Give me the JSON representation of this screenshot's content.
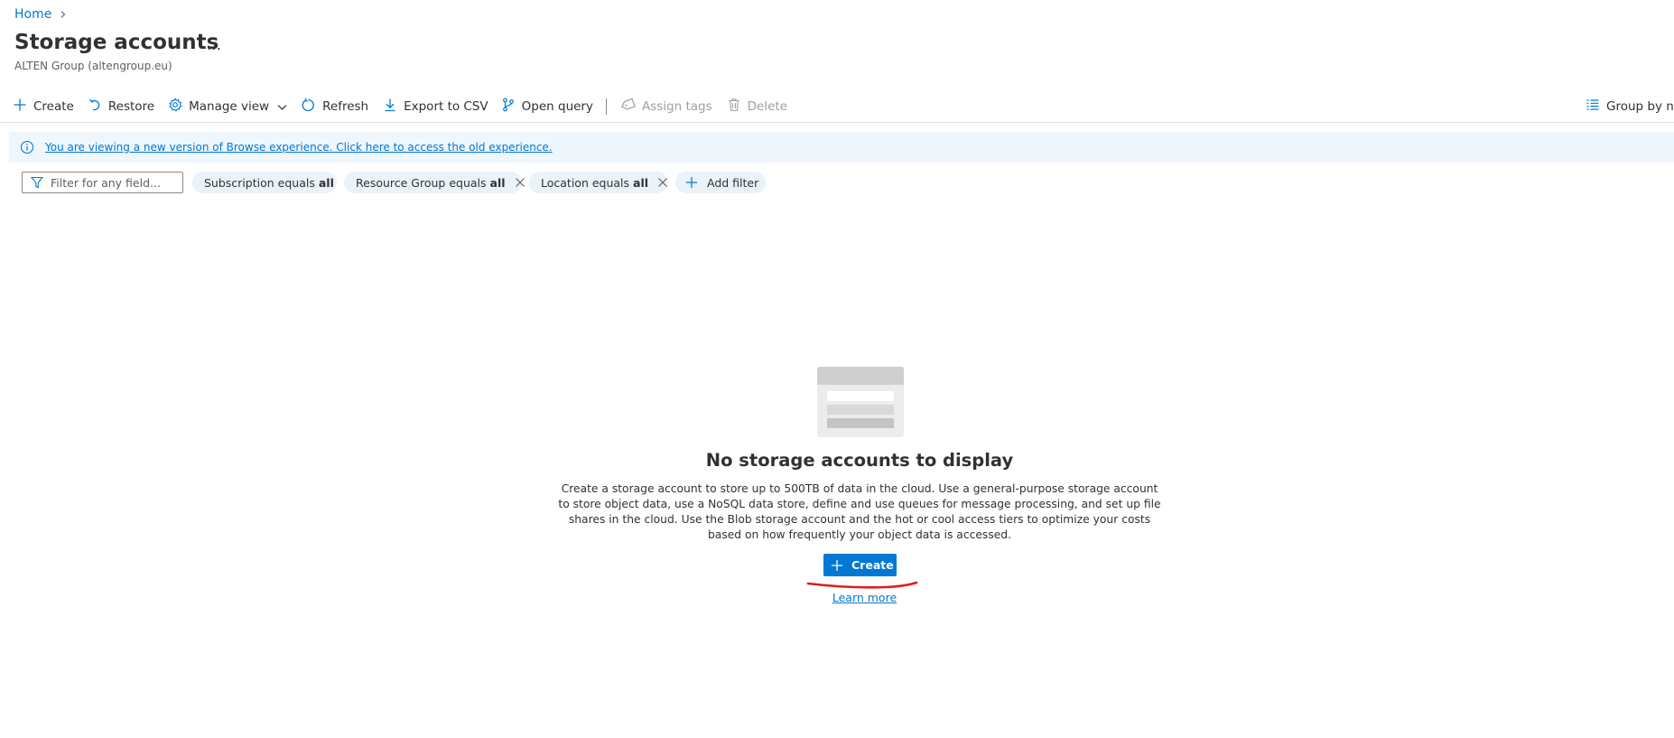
{
  "breadcrumb": {
    "home": "Home"
  },
  "header": {
    "title": "Storage accounts",
    "more": "…",
    "subtitle": "ALTEN Group (altengroup.eu)"
  },
  "toolbar": {
    "create": "Create",
    "restore": "Restore",
    "manage_view": "Manage view",
    "refresh": "Refresh",
    "export_csv": "Export to CSV",
    "open_query": "Open query",
    "assign_tags": "Assign tags",
    "delete": "Delete",
    "group_by": "Group by no"
  },
  "info_banner": {
    "text": "You are viewing a new version of Browse experience. Click here to access the old experience."
  },
  "filters": {
    "search_placeholder": "Filter for any field...",
    "pills": [
      {
        "label": "Subscription equals",
        "value": "all"
      },
      {
        "label": "Resource Group equals",
        "value": "all"
      },
      {
        "label": "Location equals",
        "value": "all"
      }
    ],
    "add_filter": "Add filter"
  },
  "empty_state": {
    "title": "No storage accounts to display",
    "description": "Create a storage account to store up to 500TB of data in the cloud. Use a general-purpose storage account to store object data, use a NoSQL data store, define and use queues for message processing, and set up file shares in the cloud. Use the Blob storage account and the hot or cool access tiers to optimize your costs based on how frequently your object data is accessed.",
    "create_button": "Create",
    "learn_more": "Learn more"
  },
  "colors": {
    "accent": "#0078d4",
    "info_banner_bg": "#eff6fc",
    "pill_bg": "#ebf2fa",
    "annotation_red": "#e11d1d"
  }
}
